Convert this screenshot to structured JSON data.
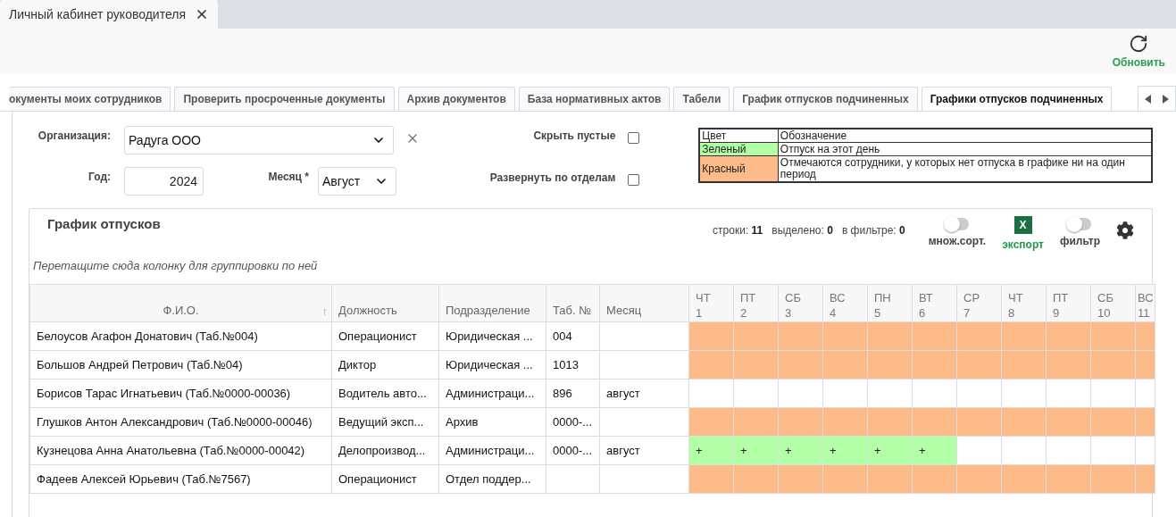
{
  "window_tab": {
    "title": "Личный кабинет руководителя"
  },
  "toolbar": {
    "refresh_label": "Обновить"
  },
  "tabs": [
    {
      "label": "окументы моих сотрудников",
      "selected": false
    },
    {
      "label": "Проверить просроченные документы",
      "selected": false
    },
    {
      "label": "Архив документов",
      "selected": false
    },
    {
      "label": "База нормативных актов",
      "selected": false
    },
    {
      "label": "Табели",
      "selected": false
    },
    {
      "label": "График отпусков подчиненных",
      "selected": false
    },
    {
      "label": "Графики отпусков подчиненных",
      "selected": true
    }
  ],
  "form": {
    "organization_label": "Организация:",
    "organization_value": "Радуга ООО",
    "year_label": "Год:",
    "year_value": "2024",
    "month_label": "Месяц *",
    "month_value": "Август",
    "options": [
      {
        "label": "Скрыть пустые",
        "checked": false
      },
      {
        "label": "Развернуть по отделам",
        "checked": false
      }
    ]
  },
  "legend": {
    "headers": [
      "Цвет",
      "Обозначение"
    ],
    "items": [
      {
        "label": "Зеленый",
        "color": "#b2ffa5",
        "meaning": "Отпуск на этот день"
      },
      {
        "label": "Красный",
        "color": "#fdbb8a",
        "meaning": "Отмечаются сотрудники, у которых нет отпуска в графике ни на один период"
      }
    ]
  },
  "grid": {
    "title": "График отпусков",
    "stats": [
      {
        "label": "строки:",
        "value": "11"
      },
      {
        "label": "выделено:",
        "value": "0"
      },
      {
        "label": "в фильтре:",
        "value": "0"
      }
    ],
    "controls": [
      {
        "kind": "toggle",
        "label": "множ.сорт.",
        "on": false
      },
      {
        "kind": "export",
        "label": "экспорт",
        "badge": "X"
      },
      {
        "kind": "toggle",
        "label": "фильтр",
        "on": false
      }
    ],
    "group_hint": "Перетащите сюда колонку для группировки по ней",
    "columns": [
      {
        "label": "Ф.И.О.",
        "sort": "↑"
      },
      {
        "label": "Должность"
      },
      {
        "label": "Подразделение"
      },
      {
        "label": "Таб. №"
      },
      {
        "label": "Месяц"
      }
    ],
    "day_columns": [
      {
        "weekday": "ЧТ",
        "day": "1"
      },
      {
        "weekday": "ПТ",
        "day": "2"
      },
      {
        "weekday": "СБ",
        "day": "3"
      },
      {
        "weekday": "ВС",
        "day": "4"
      },
      {
        "weekday": "ПН",
        "day": "5"
      },
      {
        "weekday": "ВТ",
        "day": "6"
      },
      {
        "weekday": "СР",
        "day": "7"
      },
      {
        "weekday": "ЧТ",
        "day": "8"
      },
      {
        "weekday": "ПТ",
        "day": "9"
      },
      {
        "weekday": "СБ",
        "day": "10"
      },
      {
        "weekday": "ВС",
        "day": "11"
      }
    ],
    "rows": [
      {
        "name": "Белоусов Агафон Донатович (Таб.№004)",
        "position": "Операционист",
        "department": "Юридическая ...",
        "tab": "004",
        "days": [
          {
            "kind": "no-plan"
          },
          {
            "kind": "no-plan"
          },
          {
            "kind": "no-plan"
          },
          {
            "kind": "no-plan"
          },
          {
            "kind": "no-plan"
          },
          {
            "kind": "no-plan"
          },
          {
            "kind": "no-plan"
          },
          {
            "kind": "no-plan"
          },
          {
            "kind": "no-plan"
          },
          {
            "kind": "no-plan"
          },
          {
            "kind": "no-plan"
          }
        ]
      },
      {
        "name": "Большов Андрей Петрович (Таб.№04)",
        "position": "Диктор",
        "department": "Юридическая ...",
        "tab": "1013",
        "days": [
          {
            "kind": "no-plan"
          },
          {
            "kind": "no-plan"
          },
          {
            "kind": "no-plan"
          },
          {
            "kind": "no-plan"
          },
          {
            "kind": "no-plan"
          },
          {
            "kind": "no-plan"
          },
          {
            "kind": "no-plan"
          },
          {
            "kind": "no-plan"
          },
          {
            "kind": "no-plan"
          },
          {
            "kind": "no-plan"
          },
          {
            "kind": "no-plan"
          }
        ]
      },
      {
        "name": "Борисов Тарас Игнатьевич (Таб.№0000-00036)",
        "position": "Водитель авто...",
        "department": "Администраци...",
        "tab": "896",
        "month": "август",
        "days": [
          {
            "kind": "free"
          },
          {
            "kind": "free"
          },
          {
            "kind": "free"
          },
          {
            "kind": "free"
          },
          {
            "kind": "free"
          },
          {
            "kind": "free"
          },
          {
            "kind": "free"
          },
          {
            "kind": "free"
          },
          {
            "kind": "free"
          },
          {
            "kind": "free"
          },
          {
            "kind": "free"
          }
        ]
      },
      {
        "name": "Глушков Антон Александрович (Таб.№0000-00046)",
        "position": "Ведущий эксп...",
        "department": "Архив",
        "tab": "0000-...",
        "days": [
          {
            "kind": "no-plan"
          },
          {
            "kind": "no-plan"
          },
          {
            "kind": "no-plan"
          },
          {
            "kind": "no-plan"
          },
          {
            "kind": "no-plan"
          },
          {
            "kind": "no-plan"
          },
          {
            "kind": "no-plan"
          },
          {
            "kind": "no-plan"
          },
          {
            "kind": "no-plan"
          },
          {
            "kind": "no-plan"
          },
          {
            "kind": "no-plan"
          }
        ]
      },
      {
        "name": "Кузнецова Анна Анатольевна (Таб.№0000-00042)",
        "position": "Делопроизвод...",
        "department": "Администраци...",
        "tab": "0000-...",
        "month": "август",
        "days": [
          {
            "kind": "vacation",
            "text": "+"
          },
          {
            "kind": "vacation",
            "text": "+"
          },
          {
            "kind": "vacation",
            "text": "+"
          },
          {
            "kind": "vacation",
            "text": "+"
          },
          {
            "kind": "vacation",
            "text": "+"
          },
          {
            "kind": "vacation",
            "text": "+"
          },
          {
            "kind": "free"
          },
          {
            "kind": "free"
          },
          {
            "kind": "free"
          },
          {
            "kind": "free"
          },
          {
            "kind": "free"
          }
        ]
      },
      {
        "name": "Фадеев Алексей Юрьевич (Таб.№7567)",
        "position": "Операционист",
        "department": "Отдел поддер...",
        "days": [
          {
            "kind": "no-plan"
          },
          {
            "kind": "no-plan"
          },
          {
            "kind": "no-plan"
          },
          {
            "kind": "no-plan"
          },
          {
            "kind": "no-plan"
          },
          {
            "kind": "no-plan"
          },
          {
            "kind": "no-plan"
          },
          {
            "kind": "no-plan"
          },
          {
            "kind": "no-plan"
          },
          {
            "kind": "no-plan"
          },
          {
            "kind": "no-plan"
          }
        ]
      }
    ]
  }
}
